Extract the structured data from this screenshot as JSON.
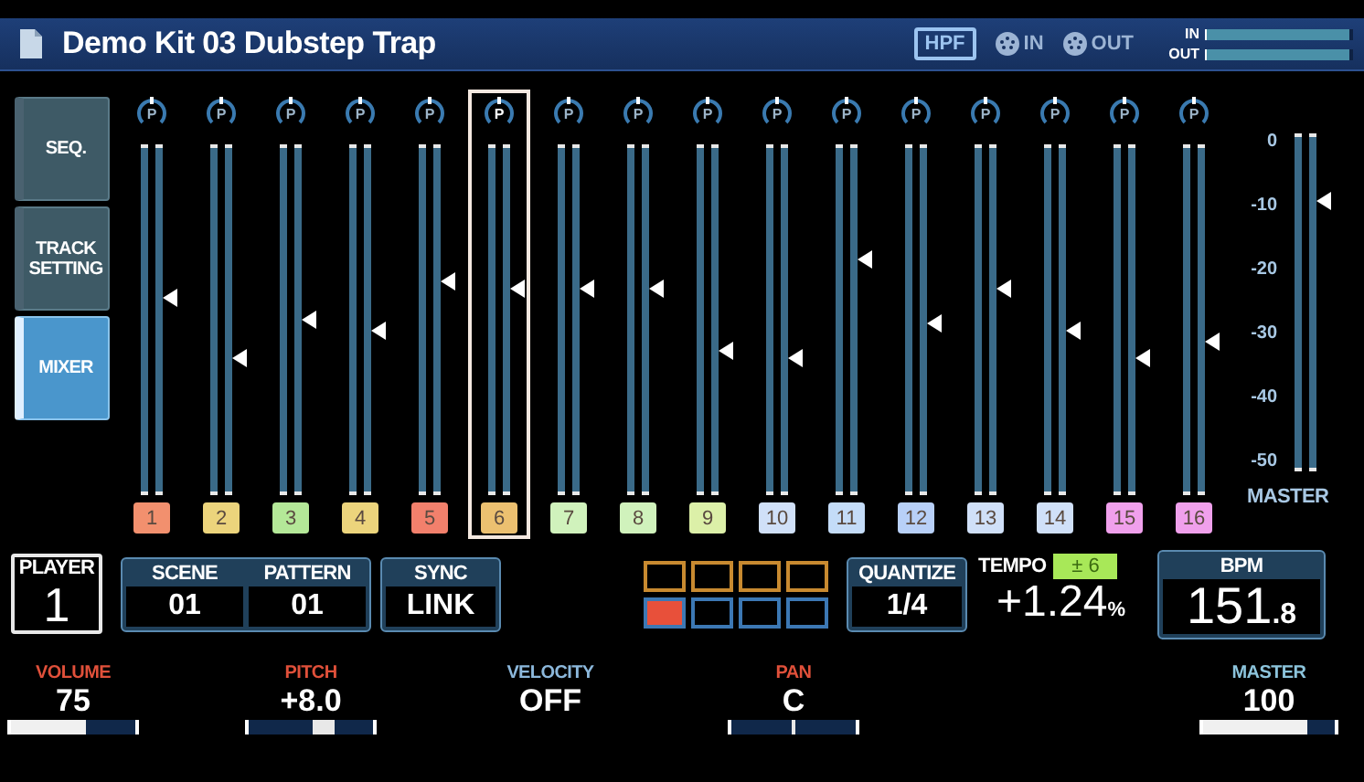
{
  "header": {
    "title": "Demo Kit 03 Dubstep Trap",
    "filter_badge": "HPF",
    "midi": [
      {
        "label": "IN"
      },
      {
        "label": "OUT"
      }
    ],
    "meters": [
      {
        "label": "IN",
        "level": 0.97
      },
      {
        "label": "OUT",
        "level": 0.97
      }
    ]
  },
  "mode_tabs": [
    {
      "label": "SEQ.",
      "selected": false
    },
    {
      "label": "TRACK SETTING",
      "selected": false
    },
    {
      "label": "MIXER",
      "selected": true
    }
  ],
  "channels": [
    {
      "knob_label": "P",
      "number": "1",
      "color": "#f2906e",
      "level": 0.56,
      "selected": false
    },
    {
      "knob_label": "P",
      "number": "2",
      "color": "#ecd47c",
      "level": 0.39,
      "selected": false
    },
    {
      "knob_label": "P",
      "number": "3",
      "color": "#b4e898",
      "level": 0.5,
      "selected": false
    },
    {
      "knob_label": "P",
      "number": "4",
      "color": "#ecd47c",
      "level": 0.47,
      "selected": false
    },
    {
      "knob_label": "P",
      "number": "5",
      "color": "#f2806c",
      "level": 0.61,
      "selected": false
    },
    {
      "knob_label": "P",
      "number": "6",
      "color": "#ecc070",
      "level": 0.59,
      "selected": true
    },
    {
      "knob_label": "P",
      "number": "7",
      "color": "#d0f2bc",
      "level": 0.59,
      "selected": false
    },
    {
      "knob_label": "P",
      "number": "8",
      "color": "#d0f2bc",
      "level": 0.59,
      "selected": false
    },
    {
      "knob_label": "P",
      "number": "9",
      "color": "#dcf0a8",
      "level": 0.41,
      "selected": false
    },
    {
      "knob_label": "P",
      "number": "10",
      "color": "#d0e0f8",
      "level": 0.39,
      "selected": false
    },
    {
      "knob_label": "P",
      "number": "11",
      "color": "#c4dcf8",
      "level": 0.67,
      "selected": false
    },
    {
      "knob_label": "P",
      "number": "12",
      "color": "#b8d0f8",
      "level": 0.49,
      "selected": false
    },
    {
      "knob_label": "P",
      "number": "13",
      "color": "#d0e0f8",
      "level": 0.59,
      "selected": false
    },
    {
      "knob_label": "P",
      "number": "14",
      "color": "#d0e0f8",
      "level": 0.47,
      "selected": false
    },
    {
      "knob_label": "P",
      "number": "15",
      "color": "#f0a0ec",
      "level": 0.39,
      "selected": false
    },
    {
      "knob_label": "P",
      "number": "16",
      "color": "#f0a0ec",
      "level": 0.44,
      "selected": false
    }
  ],
  "master": {
    "label": "MASTER",
    "scale": [
      "0",
      "-10",
      "-20",
      "-30",
      "-40",
      "-50"
    ],
    "level": 0.8
  },
  "player": {
    "label": "PLAYER",
    "value": "1"
  },
  "scene": {
    "label": "SCENE",
    "value": "01"
  },
  "pattern": {
    "label": "PATTERN",
    "value": "01"
  },
  "sync": {
    "label": "SYNC",
    "value": "LINK"
  },
  "steps": [
    {
      "color": "#c88a30",
      "active": false
    },
    {
      "color": "#c88a30",
      "active": false
    },
    {
      "color": "#c88a30",
      "active": false
    },
    {
      "color": "#c88a30",
      "active": false
    },
    {
      "color": "#3c78b4",
      "active": true
    },
    {
      "color": "#3c78b4",
      "active": false
    },
    {
      "color": "#3c78b4",
      "active": false
    },
    {
      "color": "#3c78b4",
      "active": false
    }
  ],
  "quantize": {
    "label": "QUANTIZE",
    "value": "1/4"
  },
  "tempo": {
    "label": "TEMPO",
    "range": "± 6",
    "value": "+1.24",
    "unit": "%"
  },
  "bpm": {
    "label": "BPM",
    "whole": "151",
    "fraction": ".8"
  },
  "params": [
    {
      "label": "VOLUME",
      "value": "75",
      "kind": "fill",
      "level": 0.6,
      "color": "#e0503a"
    },
    {
      "label": "PITCH",
      "value": "+8.0",
      "kind": "center",
      "level": 0.6,
      "color": "#e0503a"
    },
    {
      "label": "VELOCITY",
      "value": "OFF",
      "kind": "none",
      "color": "#8cb8dc"
    },
    {
      "label": "PAN",
      "value": "C",
      "kind": "center",
      "level": 0.5,
      "color": "#e0503a"
    },
    {
      "label": "MASTER",
      "value": "100",
      "kind": "fill",
      "level": 0.79,
      "color": "#8cc4dc"
    }
  ]
}
